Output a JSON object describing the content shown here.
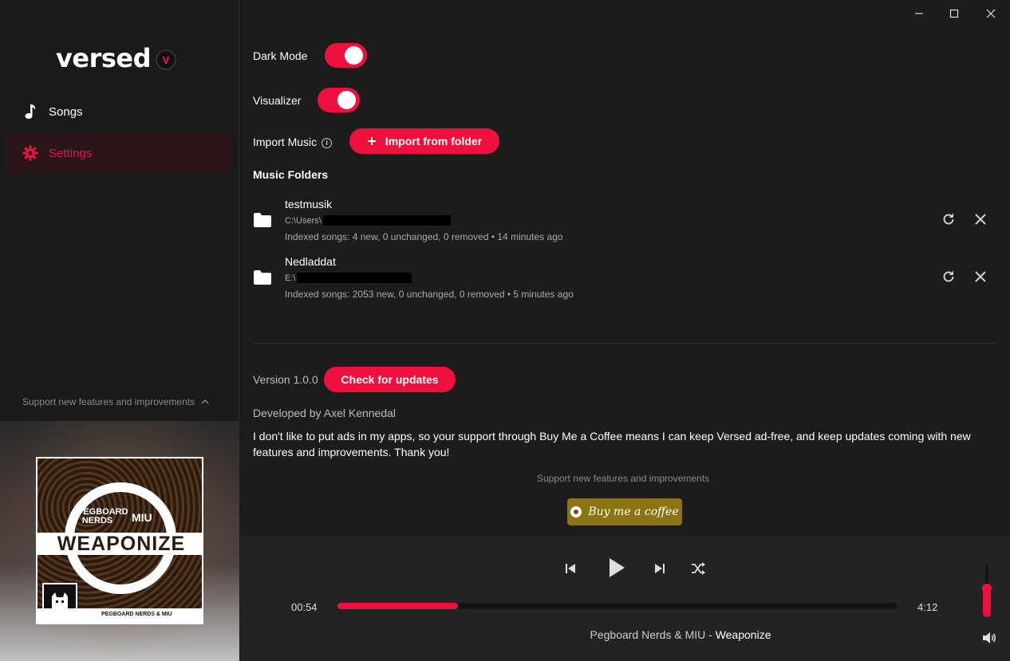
{
  "app": {
    "logo_text": "versed",
    "logo_badge": "V"
  },
  "titlebar": {
    "minimize": "minimize",
    "maximize": "maximize",
    "close": "close"
  },
  "sidebar": {
    "items": [
      {
        "label": "Songs",
        "icon": "music-note-icon",
        "active": false
      },
      {
        "label": "Settings",
        "icon": "gear-icon",
        "active": true
      }
    ],
    "support_text": "Support new features and improvements",
    "album": {
      "label_left": "PEGBOARD NERDS",
      "label_right": "MIU",
      "title": "WEAPONIZE",
      "footer": "PEGBOARD NERDS & MIU"
    }
  },
  "settings": {
    "dark_mode_label": "Dark Mode",
    "dark_mode_on": true,
    "visualizer_label": "Visualizer",
    "visualizer_on": true,
    "import_label": "Import Music",
    "import_button": "Import from folder",
    "folders_title": "Music Folders",
    "folders": [
      {
        "name": "testmusik",
        "path": "C:\\Users\\",
        "meta": "Indexed songs: 4 new, 0 unchanged, 0 removed • 14 minutes ago"
      },
      {
        "name": "Nedladdat",
        "path": "E:\\",
        "meta": "Indexed songs: 2053 new, 0 unchanged, 0 removed • 5 minutes ago"
      }
    ],
    "version": "Version 1.0.0",
    "check_updates": "Check for updates",
    "developer": "Developed by Axel Kennedal",
    "about": "I don't like to put ads in my apps, so your support through Buy Me a Coffee means I can keep Versed ad-free, and keep updates coming with new features and improvements. Thank you!",
    "support_text": "Support new features and improvements",
    "coffee_button": "Buy me a coffee"
  },
  "player": {
    "elapsed": "00:54",
    "duration": "4:12",
    "progress": 0.215,
    "volume": 0.55,
    "artist": "Pegboard Nerds & MIU",
    "separator": " - ",
    "track": "Weaponize",
    "accent": "#f0103e"
  }
}
